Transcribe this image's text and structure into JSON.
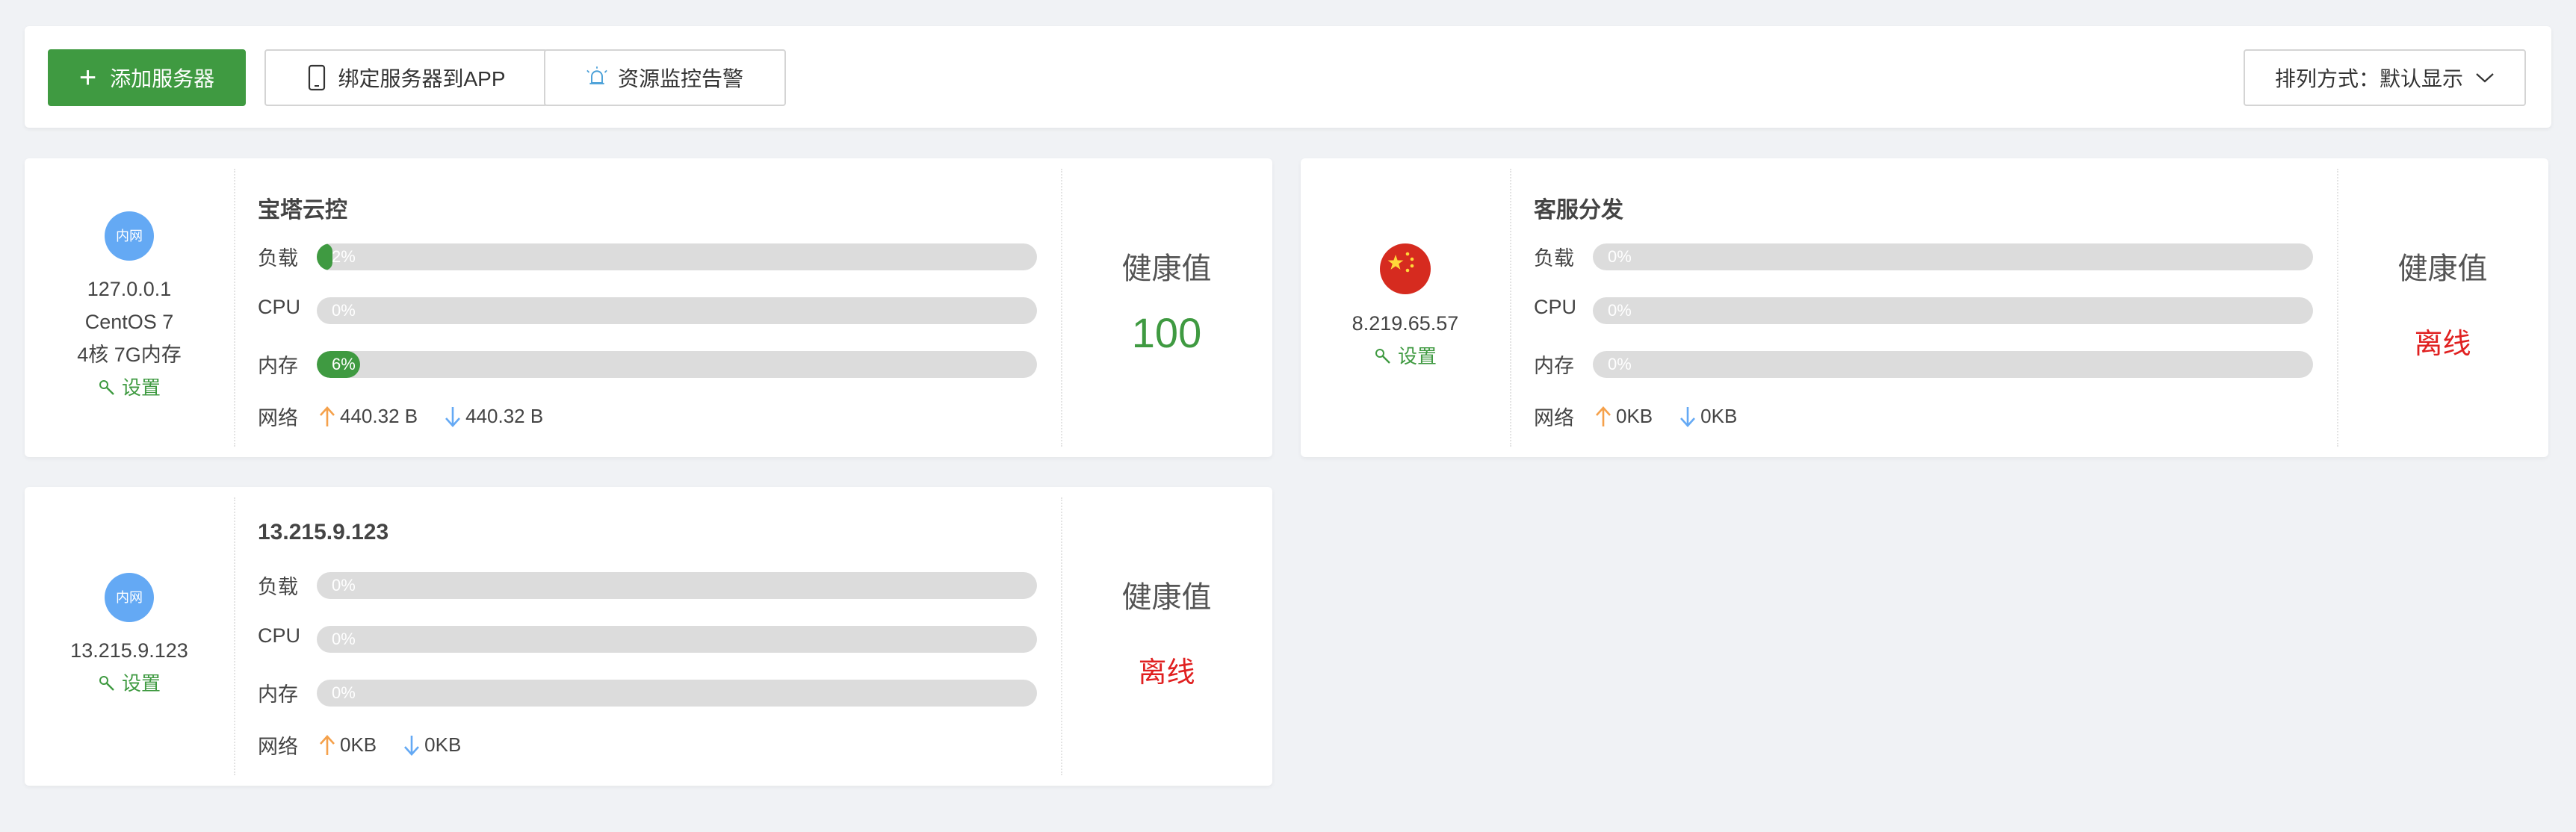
{
  "toolbar": {
    "add_label": "添加服务器",
    "bind_label": "绑定服务器到APP",
    "alarm_label": "资源监控告警",
    "sort_label": "排列方式：默认显示"
  },
  "labels": {
    "load": "负载",
    "cpu": "CPU",
    "mem": "内存",
    "net": "网络",
    "health": "健康值",
    "settings": "设置",
    "intranet": "内网"
  },
  "servers": [
    {
      "name": "宝塔云控",
      "ip": "127.0.0.1",
      "os": "CentOS 7",
      "spec": "4核 7G内存",
      "badge": "内网",
      "load": 2,
      "load_text": "2%",
      "cpu": 0,
      "cpu_text": "0%",
      "mem": 6,
      "mem_text": "6%",
      "net_up": "440.32 B",
      "net_down": "440.32 B",
      "health": "100"
    },
    {
      "name": "客服分发",
      "ip": "8.219.65.57",
      "flag": "cn-flag",
      "load": 0,
      "load_text": "0%",
      "cpu": 0,
      "cpu_text": "0%",
      "mem": 0,
      "mem_text": "0%",
      "net_up": "0KB",
      "net_down": "0KB",
      "status": "离线"
    },
    {
      "name": "13.215.9.123",
      "ip": "13.215.9.123",
      "badge": "内网",
      "load": 0,
      "load_text": "0%",
      "cpu": 0,
      "cpu_text": "0%",
      "mem": 0,
      "mem_text": "0%",
      "net_up": "0KB",
      "net_down": "0KB",
      "status": "离线"
    }
  ],
  "colors": {
    "accent": "#3f9a41",
    "offline": "#e02020",
    "badge": "#64a9f4",
    "up_arrow": "#f5a14b",
    "down_arrow": "#64a9f4"
  }
}
